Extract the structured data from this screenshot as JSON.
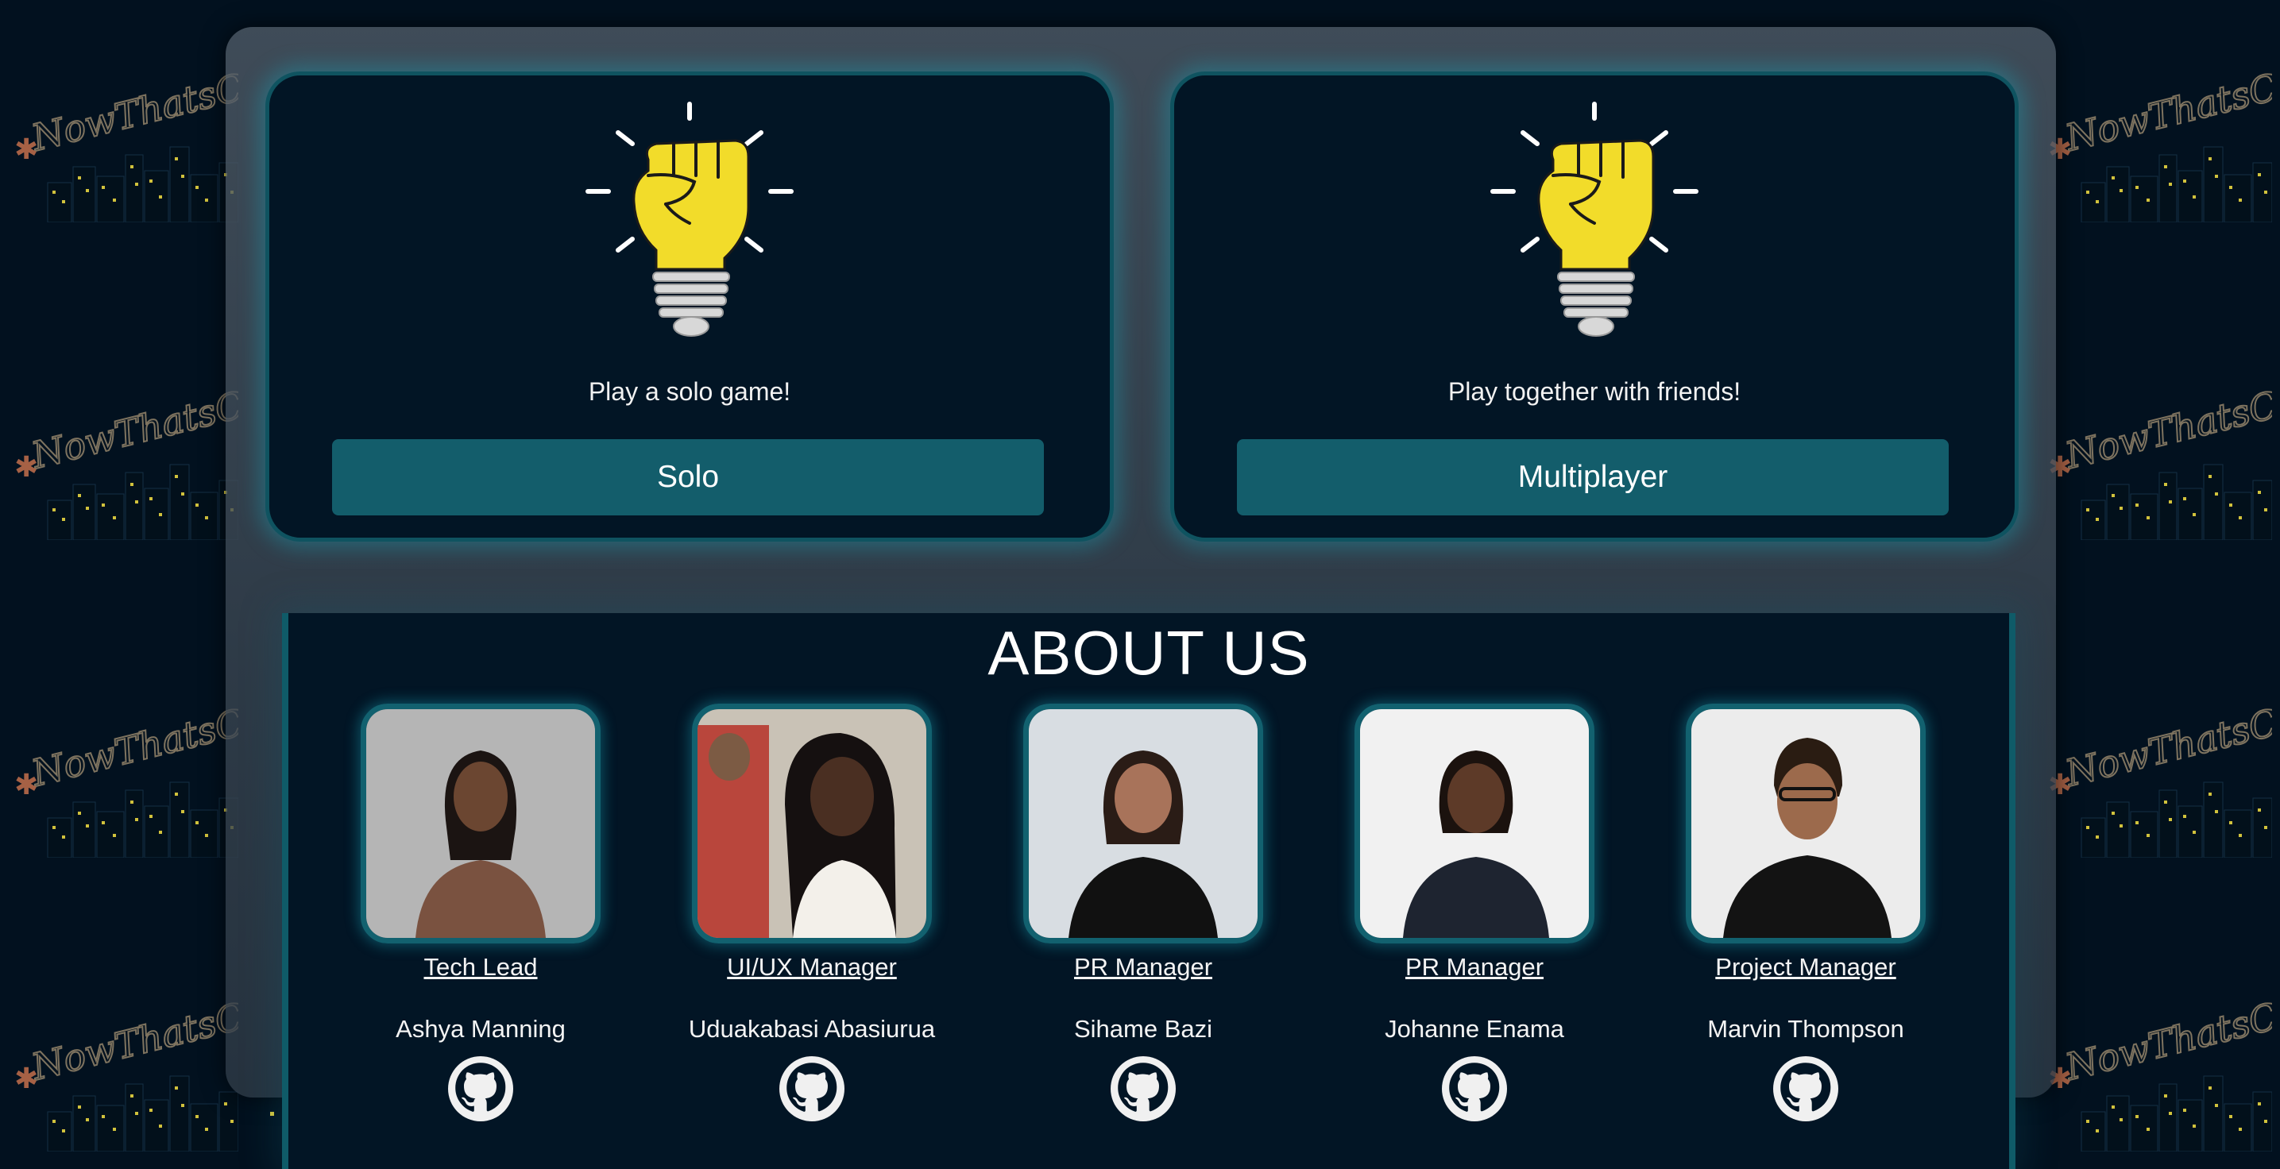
{
  "background": {
    "brand_text": "NowThatsCap",
    "colors": {
      "page": "#02111f",
      "accent": "#135d6b",
      "gold": "#f0d93a"
    }
  },
  "modes": [
    {
      "icon": "fist-lightbulb-icon",
      "text": "Play a solo game!",
      "button_label": "Solo"
    },
    {
      "icon": "fist-lightbulb-icon",
      "text": "Play together with friends!",
      "button_label": "Multiplayer"
    }
  ],
  "about": {
    "title": "ABOUT US",
    "members": [
      {
        "role": "Tech Lead",
        "name": "Ashya Manning",
        "icon": "github-icon"
      },
      {
        "role": "UI/UX Manager",
        "name": "Uduakabasi Abasiurua",
        "icon": "github-icon"
      },
      {
        "role": "PR Manager",
        "name": "Sihame Bazi",
        "icon": "github-icon"
      },
      {
        "role": "PR Manager",
        "name": "Johanne Enama",
        "icon": "github-icon"
      },
      {
        "role": "Project Manager",
        "name": "Marvin Thompson",
        "icon": "github-icon"
      }
    ]
  }
}
